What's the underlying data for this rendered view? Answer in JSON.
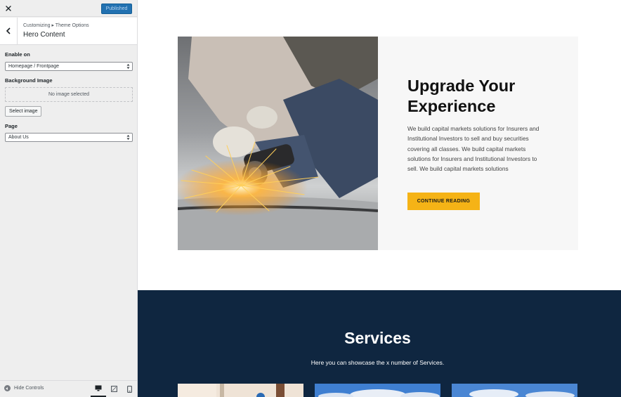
{
  "customizer": {
    "publish_label": "Published",
    "breadcrumb": "Customizing ▸ Theme Options",
    "section_title": "Hero Content",
    "controls": {
      "enable_on": {
        "label": "Enable on",
        "value": "Homepage / Frontpage"
      },
      "background_image": {
        "label": "Background Image",
        "placeholder": "No image selected",
        "button_label": "Select image"
      },
      "page": {
        "label": "Page",
        "value": "About Us"
      }
    },
    "footer": {
      "hide_controls_label": "Hide Controls",
      "devices": [
        "desktop",
        "tablet",
        "mobile"
      ],
      "active_device": "desktop"
    }
  },
  "preview": {
    "hero": {
      "title": "Upgrade Your Experience",
      "body": "We build capital markets solutions for Insurers and Institutional Investors to sell and buy securities covering all classes. We build capital markets solutions for Insurers and Institutional Investors to sell. We build capital markets solutions",
      "cta_label": "CONTINUE READING",
      "image": "worker using angle grinder with sparks"
    },
    "services": {
      "title": "Services",
      "subtitle": "Here you can showcase the x number of Services."
    }
  },
  "colors": {
    "accent": "#2271b1",
    "cta": "#f5b316",
    "services_bg": "#0f2640",
    "sidebar_bg": "#eeeeee"
  }
}
